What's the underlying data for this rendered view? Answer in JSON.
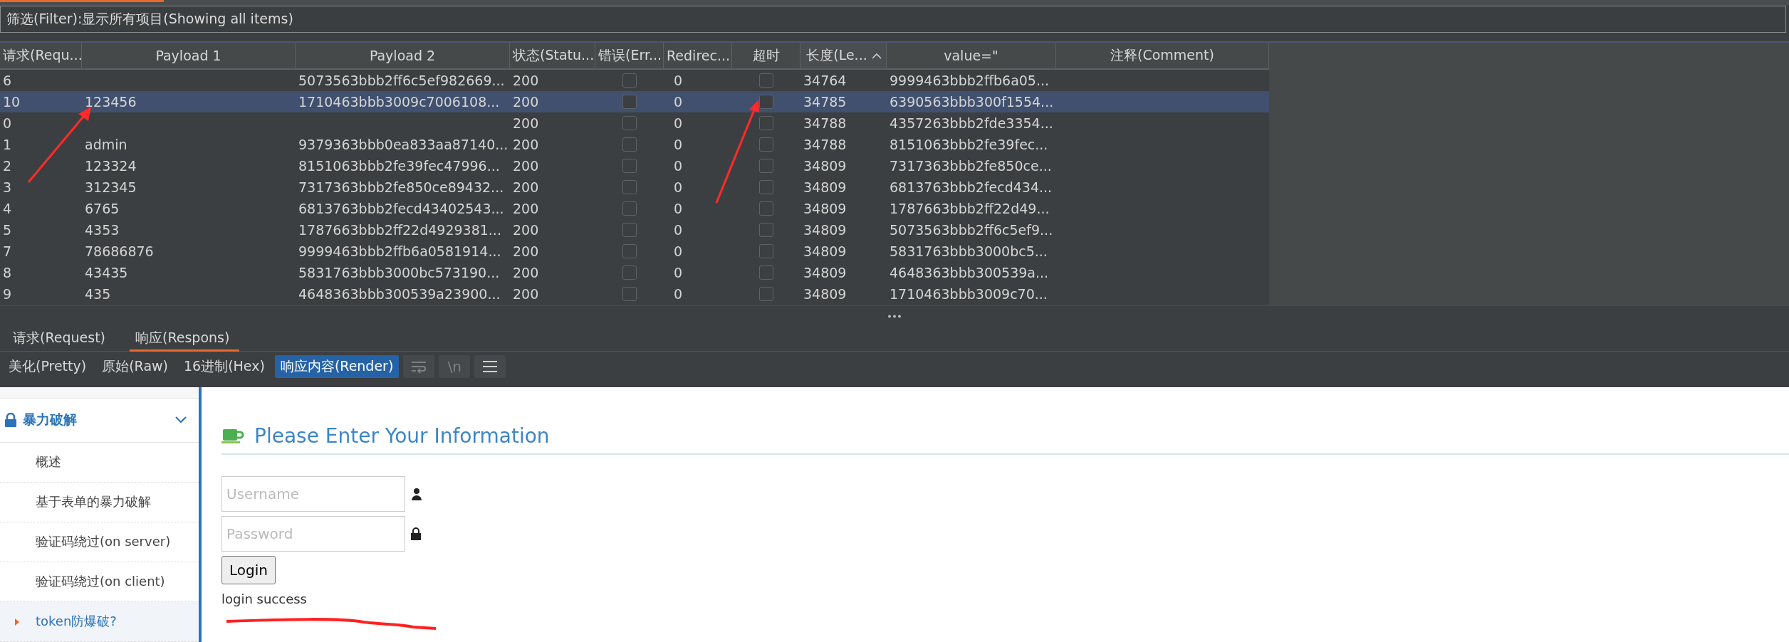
{
  "filter": {
    "label": "筛选(Filter):显示所有项目(Showing all items)"
  },
  "table": {
    "columns": [
      {
        "label": "请求(Requ...",
        "sorted": false
      },
      {
        "label": "Payload 1",
        "sorted": false
      },
      {
        "label": "Payload 2",
        "sorted": false
      },
      {
        "label": "状态(Statu...",
        "sorted": false
      },
      {
        "label": "错误(Err...",
        "sorted": false
      },
      {
        "label": "Redirec...",
        "sorted": false
      },
      {
        "label": "超时",
        "sorted": false
      },
      {
        "label": "长度(Le...",
        "sorted": true
      },
      {
        "label": "value=\"",
        "sorted": false
      },
      {
        "label": "注释(Comment)",
        "sorted": false
      }
    ],
    "rows": [
      {
        "request": "6",
        "payload2": "5073563bbb2ff6c5ef982669...",
        "status": "200",
        "error": false,
        "redirect": "0",
        "timeout": false,
        "length": "34764",
        "value": "9999463bbb2ffb6a05...",
        "selected": false
      },
      {
        "request": "10",
        "payload1": "123456",
        "payload2": "1710463bbb3009c7006108...",
        "status": "200",
        "error": false,
        "redirect": "0",
        "timeout": false,
        "length": "34785",
        "value": "6390563bbb300f1554...",
        "selected": true
      },
      {
        "request": "0",
        "status": "200",
        "error": false,
        "redirect": "0",
        "timeout": false,
        "length": "34788",
        "value": "4357263bbb2fde3354...",
        "selected": false
      },
      {
        "request": "1",
        "payload1": "admin",
        "payload2": "9379363bbb0ea833aa87140...",
        "status": "200",
        "error": false,
        "redirect": "0",
        "timeout": false,
        "length": "34788",
        "value": "8151063bbb2fe39fec...",
        "selected": false
      },
      {
        "request": "2",
        "payload1": "123324",
        "payload2": "8151063bbb2fe39fec47996...",
        "status": "200",
        "error": false,
        "redirect": "0",
        "timeout": false,
        "length": "34809",
        "value": "7317363bbb2fe850ce...",
        "selected": false
      },
      {
        "request": "3",
        "payload1": "312345",
        "payload2": "7317363bbb2fe850ce89432...",
        "status": "200",
        "error": false,
        "redirect": "0",
        "timeout": false,
        "length": "34809",
        "value": "6813763bbb2fecd434...",
        "selected": false
      },
      {
        "request": "4",
        "payload1": "6765",
        "payload2": "6813763bbb2fecd43402543...",
        "status": "200",
        "error": false,
        "redirect": "0",
        "timeout": false,
        "length": "34809",
        "value": "1787663bbb2ff22d49...",
        "selected": false
      },
      {
        "request": "5",
        "payload1": "4353",
        "payload2": "1787663bbb2ff22d4929381...",
        "status": "200",
        "error": false,
        "redirect": "0",
        "timeout": false,
        "length": "34809",
        "value": "5073563bbb2ff6c5ef9...",
        "selected": false
      },
      {
        "request": "7",
        "payload1": "78686876",
        "payload2": "9999463bbb2ffb6a0581914...",
        "status": "200",
        "error": false,
        "redirect": "0",
        "timeout": false,
        "length": "34809",
        "value": "5831763bbb3000bc5...",
        "selected": false
      },
      {
        "request": "8",
        "payload1": "43435",
        "payload2": "5831763bbb3000bc573190...",
        "status": "200",
        "error": false,
        "redirect": "0",
        "timeout": false,
        "length": "34809",
        "value": "4648363bbb300539a...",
        "selected": false
      },
      {
        "request": "9",
        "payload1": "435",
        "payload2": "4648363bbb300539a23900...",
        "status": "200",
        "error": false,
        "redirect": "0",
        "timeout": false,
        "length": "34809",
        "value": "1710463bbb3009c70...",
        "selected": false
      }
    ]
  },
  "message_tabs": [
    {
      "label": "请求(Request)",
      "selected": false
    },
    {
      "label": "响应(Respons)",
      "selected": true
    }
  ],
  "view_tabs": [
    {
      "label": "美化(Pretty)",
      "selected": false
    },
    {
      "label": "原始(Raw)",
      "selected": false
    },
    {
      "label": "16进制(Hex)",
      "selected": false
    },
    {
      "label": "响应内容(Render)",
      "selected": true
    }
  ],
  "view_tools": [
    {
      "kind": "wrap"
    },
    {
      "kind": "text",
      "label": "\\n"
    },
    {
      "kind": "menu"
    }
  ],
  "render": {
    "sidebar": {
      "title": "暴力破解",
      "expanded": true,
      "items": [
        {
          "label": "概述",
          "selected": false
        },
        {
          "label": "基于表单的暴力破解",
          "selected": false
        },
        {
          "label": "验证码绕过(on server)",
          "selected": false
        },
        {
          "label": "验证码绕过(on client)",
          "selected": false
        },
        {
          "label": "token防爆破?",
          "selected": true
        }
      ]
    },
    "heading": "Please Enter Your Information",
    "username": {
      "placeholder": "Username"
    },
    "password": {
      "placeholder": "Password"
    },
    "login_button": "Login",
    "message": "login success"
  }
}
